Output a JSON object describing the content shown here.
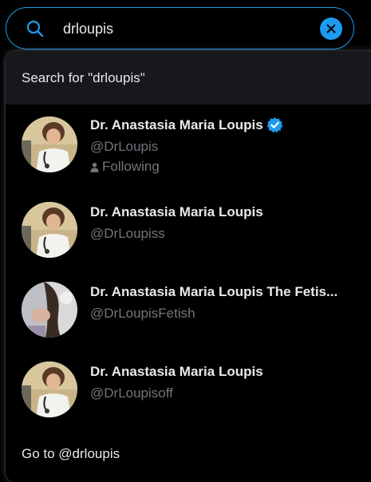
{
  "search": {
    "value": "drloupis",
    "icon": "search-icon",
    "clear_icon": "close-icon"
  },
  "dropdown": {
    "search_for": "Search for \"drloupis\"",
    "results": [
      {
        "name": "Dr. Anastasia Maria Loupis",
        "handle": "@DrLoupis",
        "verified": true,
        "following_label": "Following"
      },
      {
        "name": "Dr. Anastasia Maria Loupis",
        "handle": "@DrLoupiss",
        "verified": false
      },
      {
        "name": "Dr. Anastasia Maria Loupis The Fetis...",
        "handle": "@DrLoupisFetish",
        "verified": false
      },
      {
        "name": "Dr. Anastasia Maria Loupis",
        "handle": "@DrLoupisoff",
        "verified": false
      }
    ],
    "goto": "Go to @drloupis"
  },
  "colors": {
    "accent": "#1d9bf0",
    "background": "#000000",
    "muted_text": "#71767b",
    "highlight_row": "#16181c"
  }
}
